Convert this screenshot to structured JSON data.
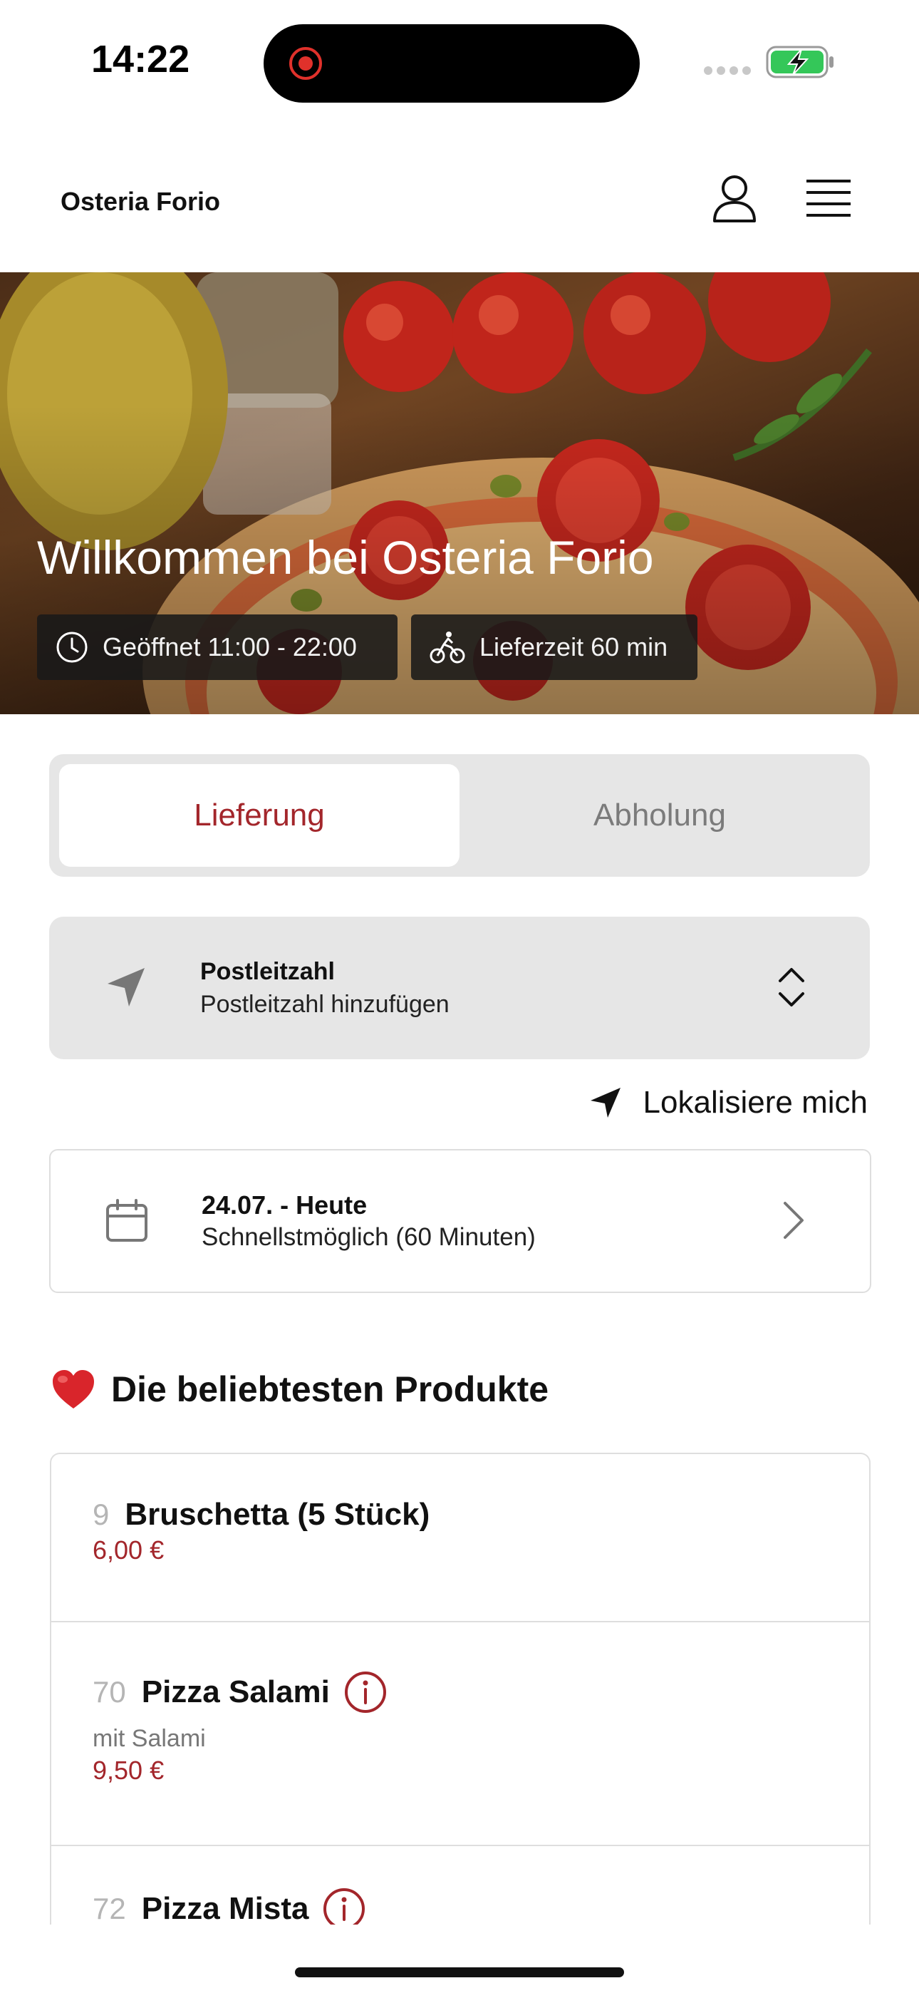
{
  "status_bar": {
    "time": "14:22"
  },
  "header": {
    "brand": "Osteria Forio"
  },
  "hero": {
    "title": "Willkommen bei Osteria Forio",
    "open_hours": "Geöffnet 11:00 - 22:00",
    "delivery_time": "Lieferzeit 60 min"
  },
  "order_mode": {
    "options": [
      "Lieferung",
      "Abholung"
    ],
    "selected": "Lieferung"
  },
  "postcode": {
    "label": "Postleitzahl",
    "placeholder": "Postleitzahl hinzufügen"
  },
  "locate_label": "Lokalisiere mich",
  "schedule": {
    "date": "24.07. - Heute",
    "time": "Schnellstmöglich (60 Minuten)"
  },
  "popular": {
    "title": "Die beliebtesten Produkte",
    "items": [
      {
        "number": "9",
        "name": "Bruschetta (5 Stück)",
        "description": "",
        "price": "6,00 €"
      },
      {
        "number": "70",
        "name": "Pizza Salami",
        "description": "mit Salami",
        "price": "9,50 €"
      },
      {
        "number": "72",
        "name": "Pizza Mista",
        "description": "",
        "price": ""
      }
    ]
  },
  "colors": {
    "accent": "#a3262b",
    "panel": "#e6e6e6",
    "chip": "#191919",
    "battery": "#34c759"
  }
}
